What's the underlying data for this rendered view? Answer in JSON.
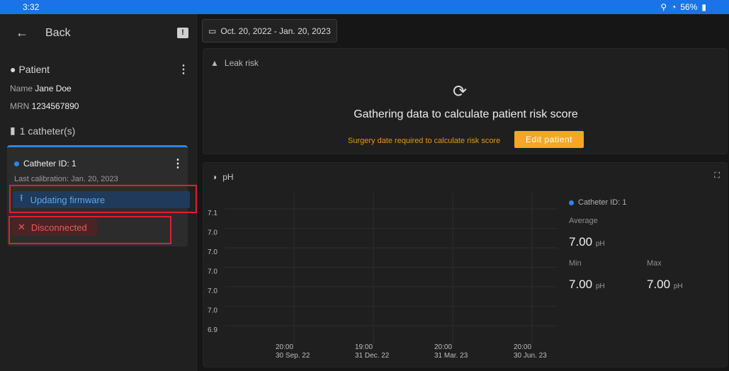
{
  "status_bar": {
    "time": "3:32",
    "battery": "56%"
  },
  "nav": {
    "back_label": "Back"
  },
  "patient": {
    "section_label": "Patient",
    "name_label": "Name",
    "name": "Jane Doe",
    "mrn_label": "MRN",
    "mrn": "1234567890",
    "catheter_count": "1 catheter(s)"
  },
  "catheter": {
    "title": "Catheter ID: 1",
    "last_calibration": "Last calibration: Jan. 20, 2023",
    "firmware_label": "Updating firmware",
    "disconnected_label": "Disconnected"
  },
  "date_range": "Oct. 20, 2022 - Jan. 20, 2023",
  "leak_risk": {
    "title": "Leak risk",
    "message": "Gathering data to calculate patient risk score",
    "surgery_note": "Surgery date required to calculate risk score",
    "edit_button": "Edit patient",
    "accent": "#f5a623"
  },
  "ph_panel": {
    "title": "pH",
    "legend_series": "Catheter ID: 1",
    "average_label": "Average",
    "average_value": "7.00",
    "min_label": "Min",
    "min_value": "7.00",
    "max_label": "Max",
    "max_value": "7.00",
    "unit": "pH"
  },
  "chart_data": {
    "type": "line",
    "y_tick_labels": [
      "7.1",
      "7.0",
      "7.0",
      "7.0",
      "7.0",
      "7.0",
      "6.9"
    ],
    "x_tick_labels": [
      {
        "time": "20:00",
        "date": "30 Sep. 22"
      },
      {
        "time": "19:00",
        "date": "31 Dec. 22"
      },
      {
        "time": "20:00",
        "date": "31 Mar. 23"
      },
      {
        "time": "20:00",
        "date": "30 Jun. 23"
      }
    ],
    "series": [
      {
        "name": "Catheter ID: 1",
        "values": []
      }
    ],
    "grid": true
  },
  "colors": {
    "primary": "#2a87e8",
    "danger": "#e85a5a",
    "warning": "#e09a1a"
  }
}
